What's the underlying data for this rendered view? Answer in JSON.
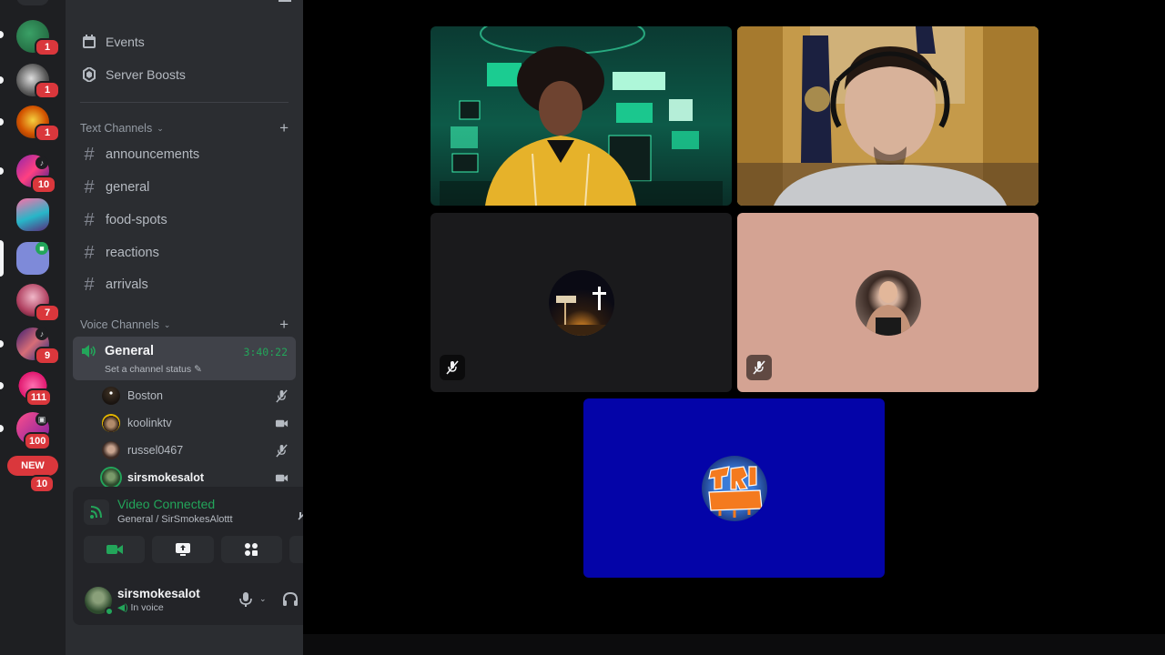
{
  "rail": {
    "badges": [
      "1",
      "1",
      "1",
      "10",
      "7",
      "9",
      "111",
      "100",
      "10"
    ],
    "new_label": "NEW"
  },
  "sidebar": {
    "menu": [
      {
        "label": "Events",
        "icon": "calendar-icon"
      },
      {
        "label": "Server Boosts",
        "icon": "boost-icon"
      }
    ],
    "text_category": "Text Channels",
    "text_channels": [
      "announcements",
      "general",
      "food-spots",
      "reactions",
      "arrivals"
    ],
    "voice_category": "Voice Channels",
    "voice_channel": {
      "name": "General",
      "timer": "3:40:22",
      "status_placeholder": "Set a channel status"
    },
    "members": [
      {
        "name": "Boston",
        "state": "mic-muted-icon"
      },
      {
        "name": "koolinktv",
        "state": "camera-icon"
      },
      {
        "name": "russel0467",
        "state": "mic-muted-icon"
      },
      {
        "name": "sirsmokesalot",
        "state": "camera-icon"
      }
    ]
  },
  "voice_panel": {
    "title": "Video Connected",
    "subtitle": "General / SirSmokesAlottt",
    "actions": [
      "camera-icon",
      "screen-share-icon",
      "activities-icon",
      "soundboard-icon"
    ]
  },
  "user": {
    "name": "sirsmokesalot",
    "status": "In voice"
  },
  "stage": {
    "tiles": [
      {
        "kind": "video",
        "speaking": false,
        "muted": false
      },
      {
        "kind": "video",
        "speaking": true,
        "muted": false
      },
      {
        "kind": "avatar",
        "speaking": false,
        "muted": true,
        "bg": "#1a1a1c"
      },
      {
        "kind": "avatar",
        "speaking": false,
        "muted": true,
        "bg": "#d4a393"
      },
      {
        "kind": "avatar",
        "speaking": false,
        "muted": false,
        "bg": "#0404a8"
      }
    ]
  },
  "colors": {
    "accent_green": "#23a55a",
    "danger_red": "#da373c",
    "sidebar": "#2b2d31",
    "rail": "#1e1f22"
  }
}
